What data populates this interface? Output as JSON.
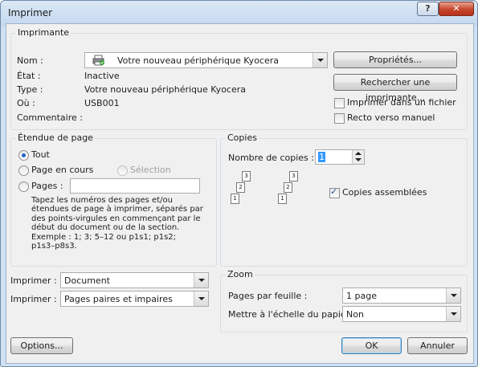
{
  "window": {
    "title": "Imprimer",
    "help_label": "?",
    "close_label": "✕"
  },
  "printer": {
    "group_label": "Imprimante",
    "name_label": "Nom :",
    "name_value": "Votre nouveau périphérique Kyocera",
    "status_label": "État :",
    "status_value": "Inactive",
    "type_label": "Type :",
    "type_value": "Votre nouveau périphérique Kyocera",
    "where_label": "Où :",
    "where_value": "USB001",
    "comment_label": "Commentaire :",
    "properties_button": "Propriétés...",
    "find_button": "Rechercher une imprimante...",
    "print_to_file_label": "Imprimer dans un fichier",
    "print_to_file_checked": false,
    "duplex_label": "Recto verso manuel",
    "duplex_checked": false
  },
  "page_range": {
    "group_label": "Étendue de page",
    "all_label": "Tout",
    "current_label": "Page en cours",
    "selection_label": "Sélection",
    "pages_label": "Pages :",
    "pages_value": "",
    "selected": "all",
    "help_lines": [
      "Tapez les numéros des pages et/ou",
      "étendues de page à imprimer, séparés par",
      "des points-virgules en commençant par le",
      "début du document ou de la section.",
      "Exemple : 1; 3; 5–12 ou p1s1; p1s2;",
      "p1s3–p8s3."
    ]
  },
  "copies": {
    "group_label": "Copies",
    "count_label": "Nombre de copies :",
    "count_value": "1",
    "collate_label": "Copies assemblées",
    "collate_checked": true,
    "stack_numbers": [
      "1",
      "2",
      "3"
    ]
  },
  "print_what": {
    "label": "Imprimer :",
    "value": "Document"
  },
  "print_pages": {
    "label": "Imprimer :",
    "value": "Pages paires et impaires"
  },
  "zoom": {
    "group_label": "Zoom",
    "per_sheet_label": "Pages par feuille :",
    "per_sheet_value": "1 page",
    "scale_label": "Mettre à l'échelle du papier :",
    "scale_value": "Non"
  },
  "footer": {
    "options_button": "Options...",
    "ok_button": "OK",
    "cancel_button": "Annuler"
  },
  "colors": {
    "title_bar": "#c4d8ee",
    "close_button": "#c6442a",
    "dialog_bg": "#f0f0f0",
    "default_border": "#3c7fb1"
  }
}
